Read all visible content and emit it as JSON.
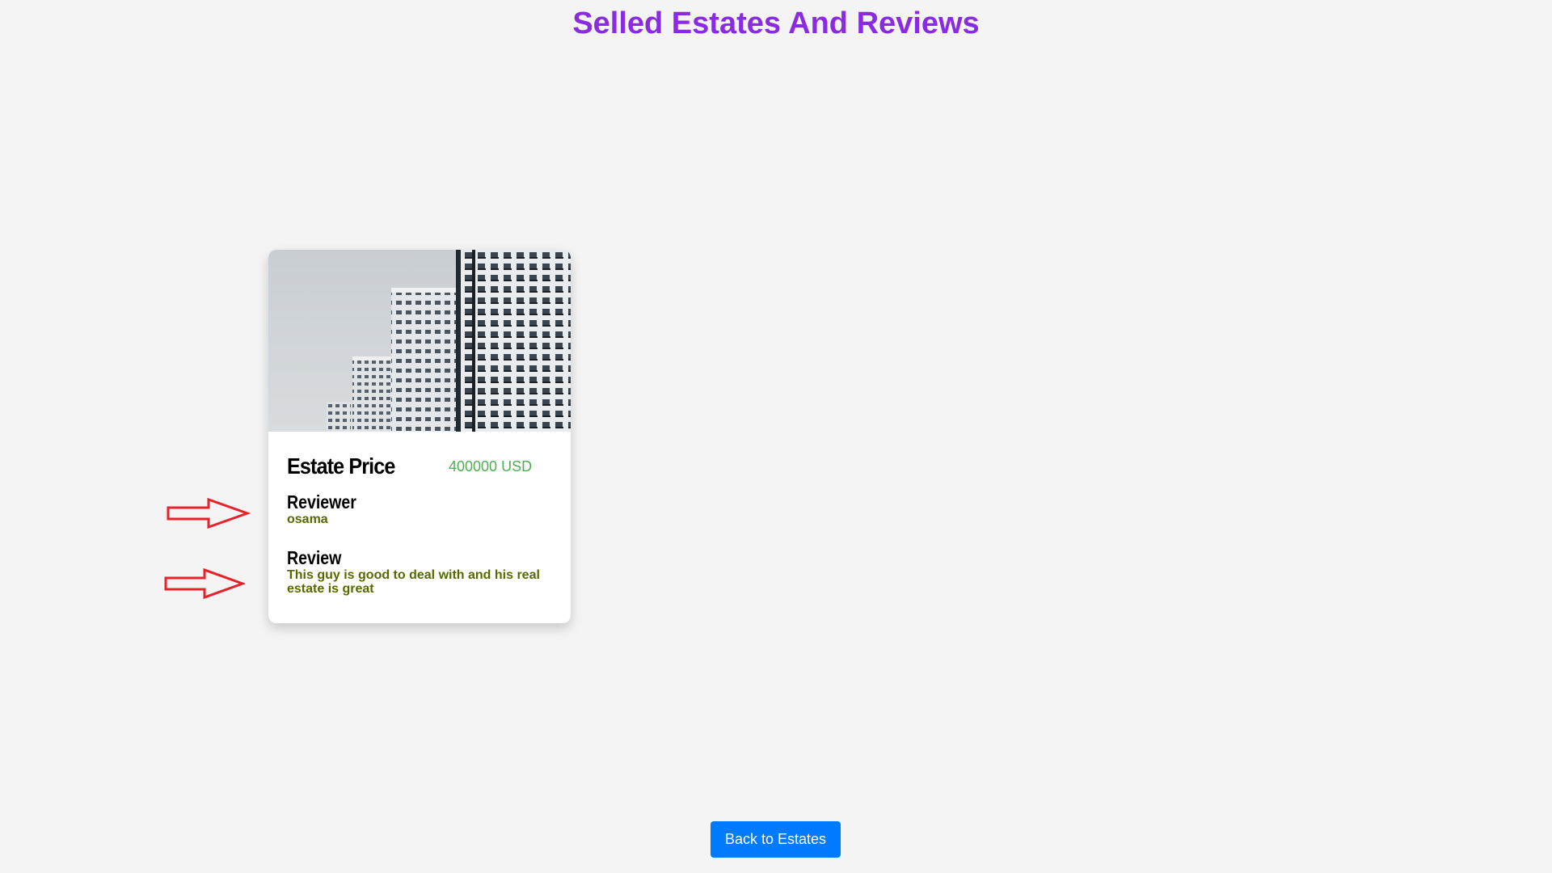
{
  "page": {
    "title": "Selled Estates And Reviews"
  },
  "estate_card": {
    "price_label": "Estate Price",
    "price_value": "400000 USD",
    "reviewer_label": "Reviewer",
    "reviewer_name": "osama",
    "review_label": "Review",
    "review_text": "This guy is good to deal with and his real estate is great"
  },
  "footer": {
    "back_button_label": "Back to Estates"
  },
  "colors": {
    "title": "#8a2be2",
    "price": "#4caf50",
    "field_value": "#556b00",
    "button": "#007bff",
    "annotation_arrow": "#e8222a"
  },
  "icons": {
    "annotation_arrow": "right-arrow-icon"
  }
}
